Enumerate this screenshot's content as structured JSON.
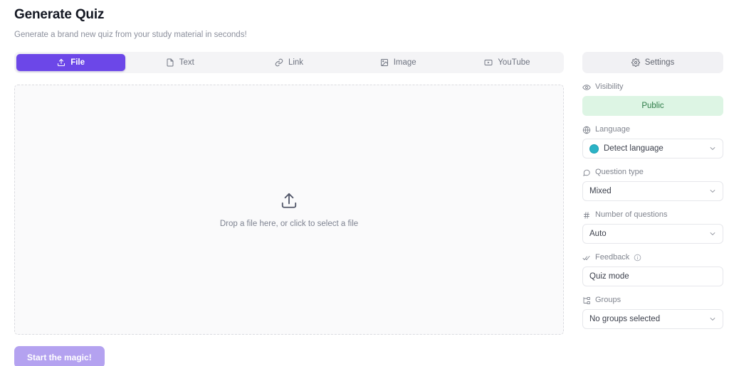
{
  "header": {
    "title": "Generate Quiz",
    "subtitle": "Generate a brand new quiz from your study material in seconds!"
  },
  "tabs": [
    {
      "label": "File",
      "icon": "upload-icon",
      "active": true
    },
    {
      "label": "Text",
      "icon": "document-icon",
      "active": false
    },
    {
      "label": "Link",
      "icon": "link-icon",
      "active": false
    },
    {
      "label": "Image",
      "icon": "image-icon",
      "active": false
    },
    {
      "label": "YouTube",
      "icon": "video-icon",
      "active": false
    }
  ],
  "dropzone": {
    "icon": "upload-icon",
    "text": "Drop a file here, or click to select a file"
  },
  "actions": {
    "start_label": "Start the magic!"
  },
  "settings": {
    "button_label": "Settings",
    "button_icon": "gear-icon",
    "fields": [
      {
        "label": "Visibility",
        "icon": "eye-icon",
        "value": "Public",
        "control": "pill"
      },
      {
        "label": "Language",
        "icon": "globe-icon",
        "value": "Detect language",
        "control": "select"
      },
      {
        "label": "Question type",
        "icon": "chat-icon",
        "value": "Mixed",
        "control": "select"
      },
      {
        "label": "Number of questions",
        "icon": "hash-icon",
        "value": "Auto",
        "control": "select"
      },
      {
        "label": "Feedback",
        "icon": "checks-icon",
        "value": "Quiz mode",
        "control": "plain"
      },
      {
        "label": "Groups",
        "icon": "hierarchy-icon",
        "value": "No groups selected",
        "control": "select"
      }
    ]
  },
  "colors": {
    "accent": "#6c47e8",
    "accent_muted": "#b4a2f0",
    "public_bg": "#ddf5e4",
    "public_text": "#2c7a46",
    "globe_badge": "#2bb3c6"
  }
}
